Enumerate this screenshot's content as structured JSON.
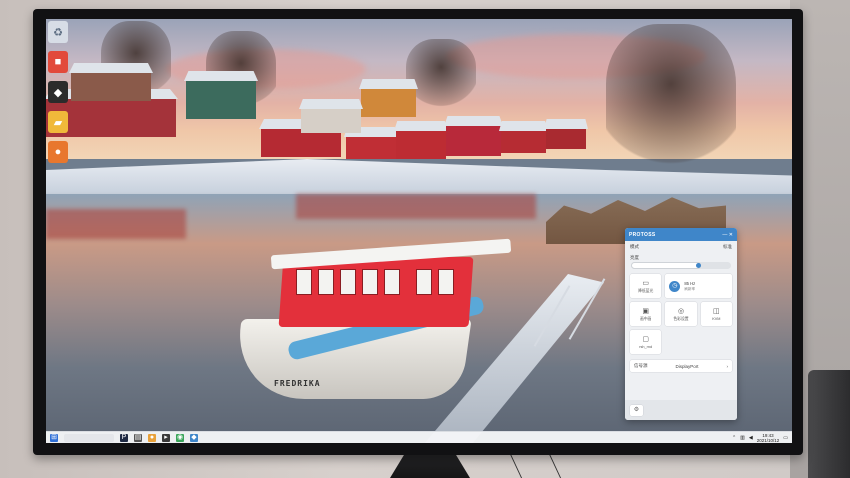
{
  "desktop": {
    "icons": [
      {
        "name": "recycle-bin-icon",
        "color": "#d7dde6",
        "glyph": "♻"
      },
      {
        "name": "app-icon-red",
        "color": "#e24a3b",
        "glyph": "■"
      },
      {
        "name": "app-icon-dark",
        "color": "#2b2b2b",
        "glyph": "◆"
      },
      {
        "name": "folder-icon",
        "color": "#f0b93a",
        "glyph": "▰"
      },
      {
        "name": "app-icon-orange",
        "color": "#e8772e",
        "glyph": "●"
      }
    ],
    "boat_name": "FREDRIKA"
  },
  "panel": {
    "title": "PROTOSS",
    "header_controls": "— ✕",
    "mode_label": "模式",
    "mode_value": "标准",
    "brightness_label": "亮度",
    "brightness_level": 0.7,
    "wide_tile": {
      "line1": "85 Hz",
      "line2": "刷新率"
    },
    "tiles": [
      {
        "icon": "▭",
        "label": "降低蓝光"
      },
      {
        "icon": "▣",
        "label": "画中画"
      },
      {
        "icon": "◎",
        "label": "色彩设置"
      },
      {
        "icon": "◫",
        "label": "KVM"
      },
      {
        "icon": "▢",
        "label": "rsh_rnd"
      }
    ],
    "source_label": "信号源",
    "source_value": "DisplayPort",
    "source_chevron": "›",
    "footer_icon": "settings-icon"
  },
  "taskbar": {
    "search_placeholder": "",
    "time": "19:43",
    "date": "2021/10/12",
    "accent": "#3f86c9"
  }
}
